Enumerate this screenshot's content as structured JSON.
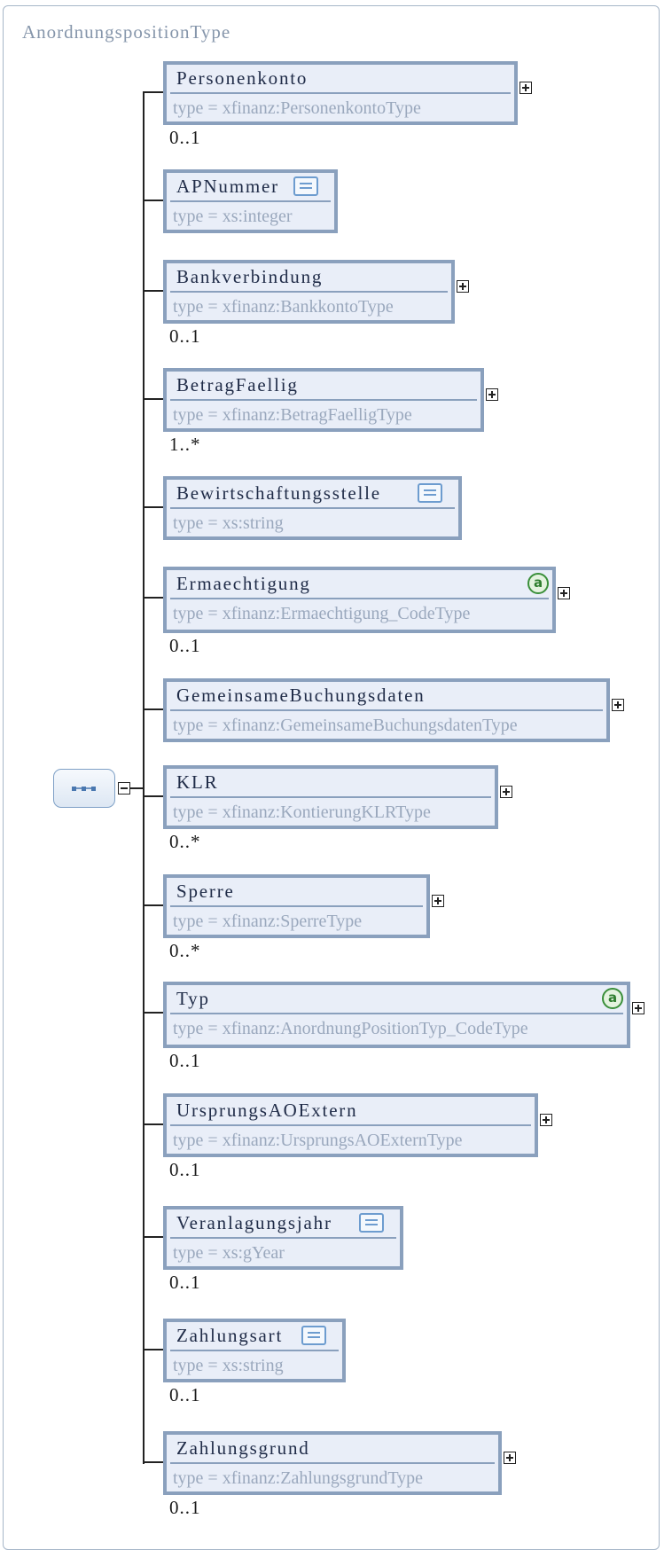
{
  "diagram": {
    "title": "AnordnungspositionType",
    "elements": [
      {
        "name": "Personenkonto",
        "type": "type = xfinanz:PersonenkontoType",
        "cardinality": "0..1",
        "expandable": true,
        "doc": false,
        "attr": false
      },
      {
        "name": "APNummer",
        "type": "type = xs:integer",
        "cardinality": "",
        "expandable": false,
        "doc": true,
        "attr": false
      },
      {
        "name": "Bankverbindung",
        "type": "type = xfinanz:BankkontoType",
        "cardinality": "0..1",
        "expandable": true,
        "doc": false,
        "attr": false
      },
      {
        "name": "BetragFaellig",
        "type": "type = xfinanz:BetragFaelligType",
        "cardinality": "1..*",
        "expandable": true,
        "doc": false,
        "attr": false
      },
      {
        "name": "Bewirtschaftungsstelle",
        "type": "type = xs:string",
        "cardinality": "",
        "expandable": false,
        "doc": true,
        "attr": false
      },
      {
        "name": "Ermaechtigung",
        "type": "type = xfinanz:Ermaechtigung_CodeType",
        "cardinality": "0..1",
        "expandable": true,
        "doc": false,
        "attr": true
      },
      {
        "name": "GemeinsameBuchungsdaten",
        "type": "type = xfinanz:GemeinsameBuchungsdatenType",
        "cardinality": "",
        "expandable": true,
        "doc": false,
        "attr": false
      },
      {
        "name": "KLR",
        "type": "type = xfinanz:KontierungKLRType",
        "cardinality": "0..*",
        "expandable": true,
        "doc": false,
        "attr": false
      },
      {
        "name": "Sperre",
        "type": "type = xfinanz:SperreType",
        "cardinality": "0..*",
        "expandable": true,
        "doc": false,
        "attr": false
      },
      {
        "name": "Typ",
        "type": "type = xfinanz:AnordnungPositionTyp_CodeType",
        "cardinality": "0..1",
        "expandable": true,
        "doc": false,
        "attr": true
      },
      {
        "name": "UrsprungsAOExtern",
        "type": "type = xfinanz:UrsprungsAOExternType",
        "cardinality": "0..1",
        "expandable": true,
        "doc": false,
        "attr": false
      },
      {
        "name": "Veranlagungsjahr",
        "type": "type = xs:gYear",
        "cardinality": "0..1",
        "expandable": false,
        "doc": true,
        "attr": false
      },
      {
        "name": "Zahlungsart",
        "type": "type = xs:string",
        "cardinality": "0..1",
        "expandable": false,
        "doc": true,
        "attr": false
      },
      {
        "name": "Zahlungsgrund",
        "type": "type = xfinanz:ZahlungsgrundType",
        "cardinality": "0..1",
        "expandable": true,
        "doc": false,
        "attr": false
      }
    ],
    "attr_symbol": "a"
  }
}
